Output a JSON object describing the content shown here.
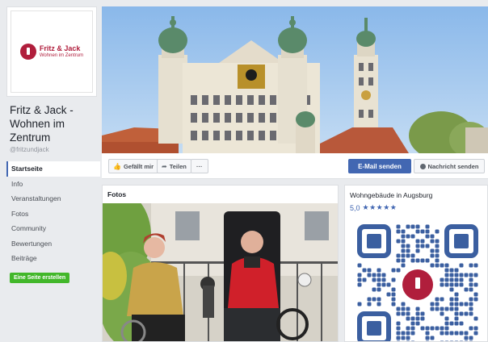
{
  "profile": {
    "logo_title": "Fritz & Jack",
    "logo_subtitle": "Wohnen im Zentrum",
    "name": "Fritz & Jack - Wohnen im Zentrum",
    "handle": "@fritzundjack"
  },
  "nav": {
    "items": [
      "Startseite",
      "Info",
      "Veranstaltungen",
      "Fotos",
      "Community",
      "Bewertungen",
      "Beiträge"
    ],
    "active": "Startseite",
    "create_button": "Eine Seite erstellen"
  },
  "actions": {
    "like": "Gefällt mir",
    "share": "Teilen",
    "more": "···",
    "email": "E-Mail senden",
    "message": "Nachricht senden"
  },
  "photos": {
    "title": "Fotos"
  },
  "info": {
    "category": "Wohngebäude in Augsburg",
    "rating": "5,0",
    "stars": "★★★★★"
  },
  "colors": {
    "brand_red": "#b01e3c",
    "facebook_blue": "#4267b2",
    "green": "#42b72a",
    "background": "#e9ebee"
  }
}
